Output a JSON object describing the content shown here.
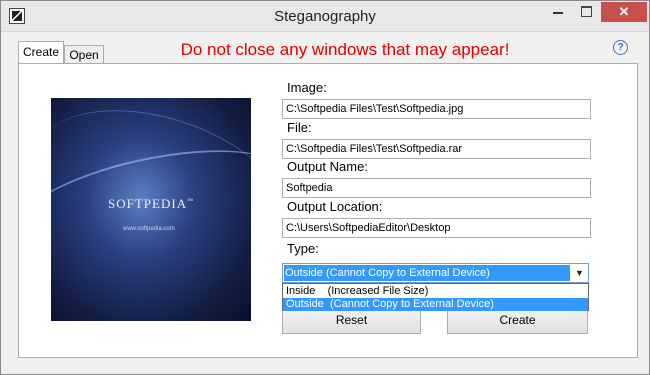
{
  "window": {
    "title": "Steganography",
    "minimize_label": "",
    "maximize_label": "",
    "close_label": "✕"
  },
  "tabs": [
    {
      "label": "Create",
      "active": true
    },
    {
      "label": "Open",
      "active": false
    }
  ],
  "warning": "Do not close any windows that may appear!",
  "help_icon": "?",
  "preview": {
    "logo_text": "SOFTPEDIA",
    "trademark": "™",
    "url_text": "www.softpedia.com"
  },
  "form": {
    "image_label": "Image:",
    "image_value": "C:\\Softpedia Files\\Test\\Softpedia.jpg",
    "file_label": "File:",
    "file_value": "C:\\Softpedia Files\\Test\\Softpedia.rar",
    "output_name_label": "Output Name:",
    "output_name_value": "Softpedia",
    "output_location_label": "Output Location:",
    "output_location_value": "C:\\Users\\SoftpediaEditor\\Desktop",
    "type_label": "Type:",
    "type_selected": "Outside  (Cannot Copy to External Device)",
    "type_options": [
      "Inside    (Increased File Size)",
      "Outside  (Cannot Copy to External Device)"
    ]
  },
  "buttons": {
    "reset": "Reset",
    "create": "Create"
  },
  "colors": {
    "warning": "#e00000",
    "selection": "#3399ff",
    "close_button": "#c7504b"
  }
}
